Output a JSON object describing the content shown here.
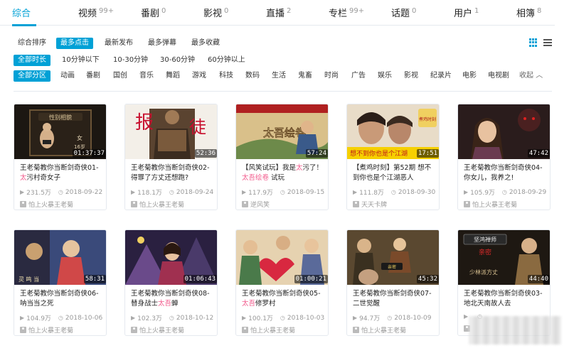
{
  "tabs": [
    {
      "label": "综合",
      "count": ""
    },
    {
      "label": "视频",
      "count": "99+"
    },
    {
      "label": "番剧",
      "count": "0"
    },
    {
      "label": "影视",
      "count": "0"
    },
    {
      "label": "直播",
      "count": "2"
    },
    {
      "label": "专栏",
      "count": "99+"
    },
    {
      "label": "话题",
      "count": "0"
    },
    {
      "label": "用户",
      "count": "1"
    },
    {
      "label": "相簿",
      "count": "8"
    }
  ],
  "sort": [
    "综合排序",
    "最多点击",
    "最新发布",
    "最多弹幕",
    "最多收藏"
  ],
  "duration": [
    "全部时长",
    "10分钟以下",
    "10-30分钟",
    "30-60分钟",
    "60分钟以上"
  ],
  "zones": [
    "全部分区",
    "动画",
    "番剧",
    "国创",
    "音乐",
    "舞蹈",
    "游戏",
    "科技",
    "数码",
    "生活",
    "鬼畜",
    "时尚",
    "广告",
    "娱乐",
    "影视",
    "纪录片",
    "电影",
    "电视剧"
  ],
  "collapse_label": "收起",
  "videos": [
    {
      "title_pre": "王老菊教你当断剑奇侠01-",
      "title_hl": "太",
      "title_post": "污村奇女子",
      "duration": "01:37:37",
      "views": "231.5万",
      "date": "2018-09-22",
      "uploader": "怕上火暴王老菊"
    },
    {
      "title_pre": "王老菊教你当断剑奇侠02-得罪了方丈还想跑?",
      "title_hl": "",
      "title_post": "",
      "duration": "52:36",
      "views": "118.1万",
      "date": "2018-09-24",
      "uploader": "怕上火暴王老菊"
    },
    {
      "title_pre": "【风笑试玩】我是",
      "title_hl": "太",
      "title_post": "污了！",
      "title_pre2": "",
      "title_hl2": "太吾绘卷",
      "title_post2": " 试玩",
      "duration": "57:24",
      "views": "117.9万",
      "date": "2018-09-15",
      "uploader": "逆风笑"
    },
    {
      "title_pre": "【煮鸡时刻】第52期 想不到你也是个江湖恶人",
      "title_hl": "",
      "title_post": "",
      "duration": "17:51",
      "views": "111.8万",
      "date": "2018-09-30",
      "uploader": "天天卡牌"
    },
    {
      "title_pre": "王老菊教你当断剑奇侠04-你女儿，我养之!",
      "title_hl": "",
      "title_post": "",
      "duration": "47:42",
      "views": "105.9万",
      "date": "2018-09-29",
      "uploader": "怕上火暴王老菊"
    },
    {
      "title_pre": "王老菊教你当断剑奇侠06-呐当当之死",
      "title_hl": "",
      "title_post": "",
      "duration": "58:31",
      "views": "104.9万",
      "date": "2018-10-06",
      "uploader": "怕上火暴王老菊"
    },
    {
      "title_pre": "王老菊教你当断剑奇侠08-替身战士",
      "title_hl": "太吾",
      "title_post": "蝉",
      "duration": "01:06:43",
      "views": "102.3万",
      "date": "2018-10-12",
      "uploader": "怕上火暴王老菊"
    },
    {
      "title_pre": "王老菊教你当断剑奇侠05-",
      "title_hl": "太吾",
      "title_post": "修罗村",
      "duration": "01:00:21",
      "views": "100.1万",
      "date": "2018-10-03",
      "uploader": "怕上火暴王老菊"
    },
    {
      "title_pre": "王老菊教你当断剑奇侠07-二世觉醒",
      "title_hl": "",
      "title_post": "",
      "duration": "45:32",
      "views": "94.7万",
      "date": "2018-10-09",
      "uploader": "怕上火暴王老菊"
    },
    {
      "title_pre": "王老菊教你当断剑奇侠03-地北天南故人去",
      "title_hl": "",
      "title_post": "",
      "duration": "44:40",
      "views": "",
      "date": "",
      "uploader": ""
    }
  ],
  "thumb_text": {
    "t1_label": "性别相貌",
    "t1_gender": "女",
    "t1_age": "16岁",
    "t2_big1": "报",
    "t2_big2": "徒",
    "t3_logo": "太吾绘卷",
    "t4_banner": "想不到你也是个江湖",
    "t4_corner": "煮鸡时刻",
    "t6_name": "灵 鸣 当",
    "t9_label": "亲密",
    "t10_top": "坚鸿禅师",
    "t10_mid": "亲密",
    "t10_bottom": "少林派方丈"
  },
  "colors": {
    "accent": "#00a1d6",
    "highlight": "#f25d8e"
  }
}
